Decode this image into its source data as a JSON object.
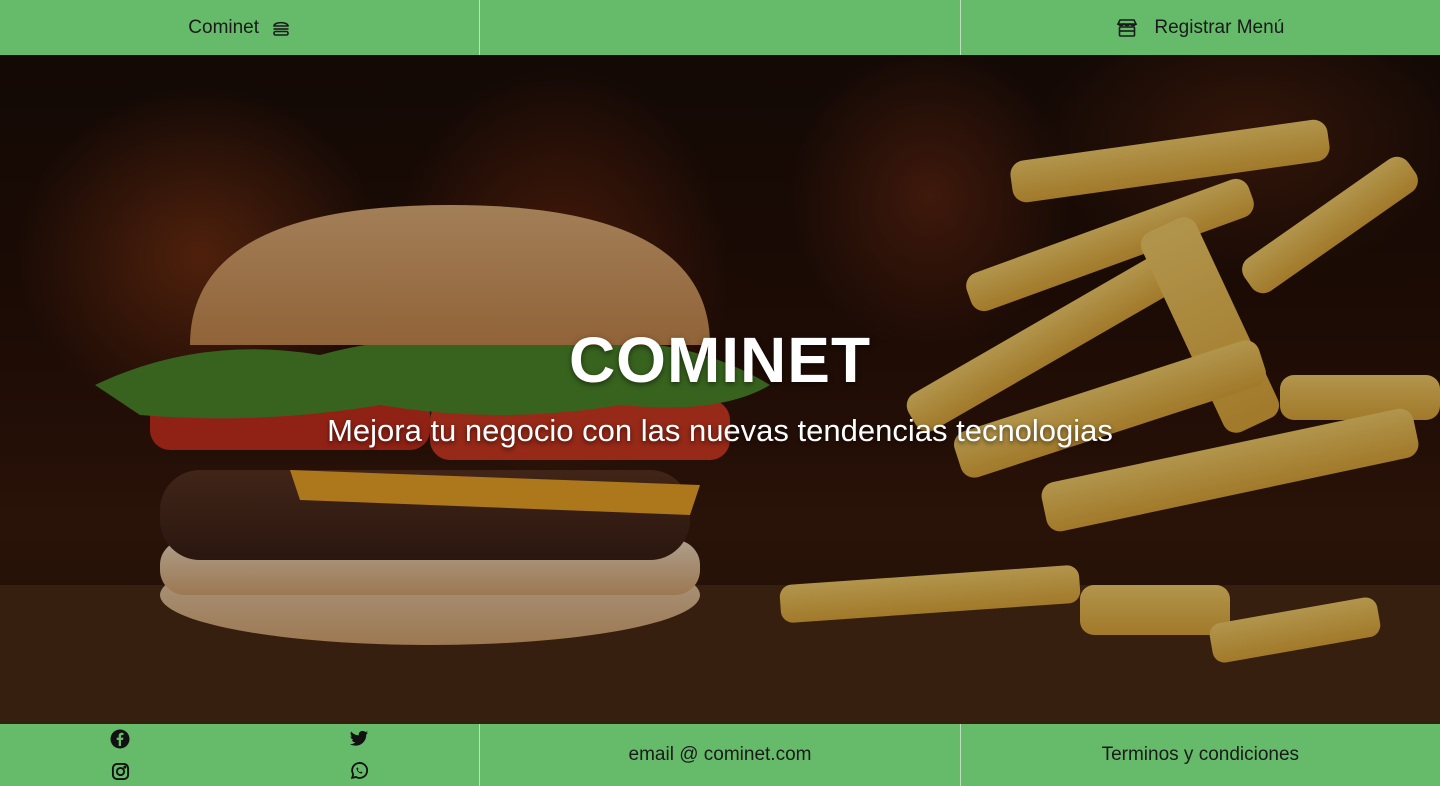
{
  "header": {
    "brand_label": "Cominet",
    "brand_icon": "burger-icon",
    "register_label": "Registrar Menú",
    "register_icon": "store-icon"
  },
  "hero": {
    "title": "COMINET",
    "subtitle": "Mejora tu negocio con las nuevas tendencias tecnologias",
    "background": "burger-and-fries-photo"
  },
  "footer": {
    "socials": [
      "facebook-icon",
      "twitter-icon",
      "instagram-icon",
      "whatsapp-icon"
    ],
    "email": "email @ cominet.com",
    "terms": "Terminos y condiciones"
  },
  "colors": {
    "bar": "#66bb6a",
    "text": "#1a1a1a",
    "hero_text": "#ffffff"
  }
}
